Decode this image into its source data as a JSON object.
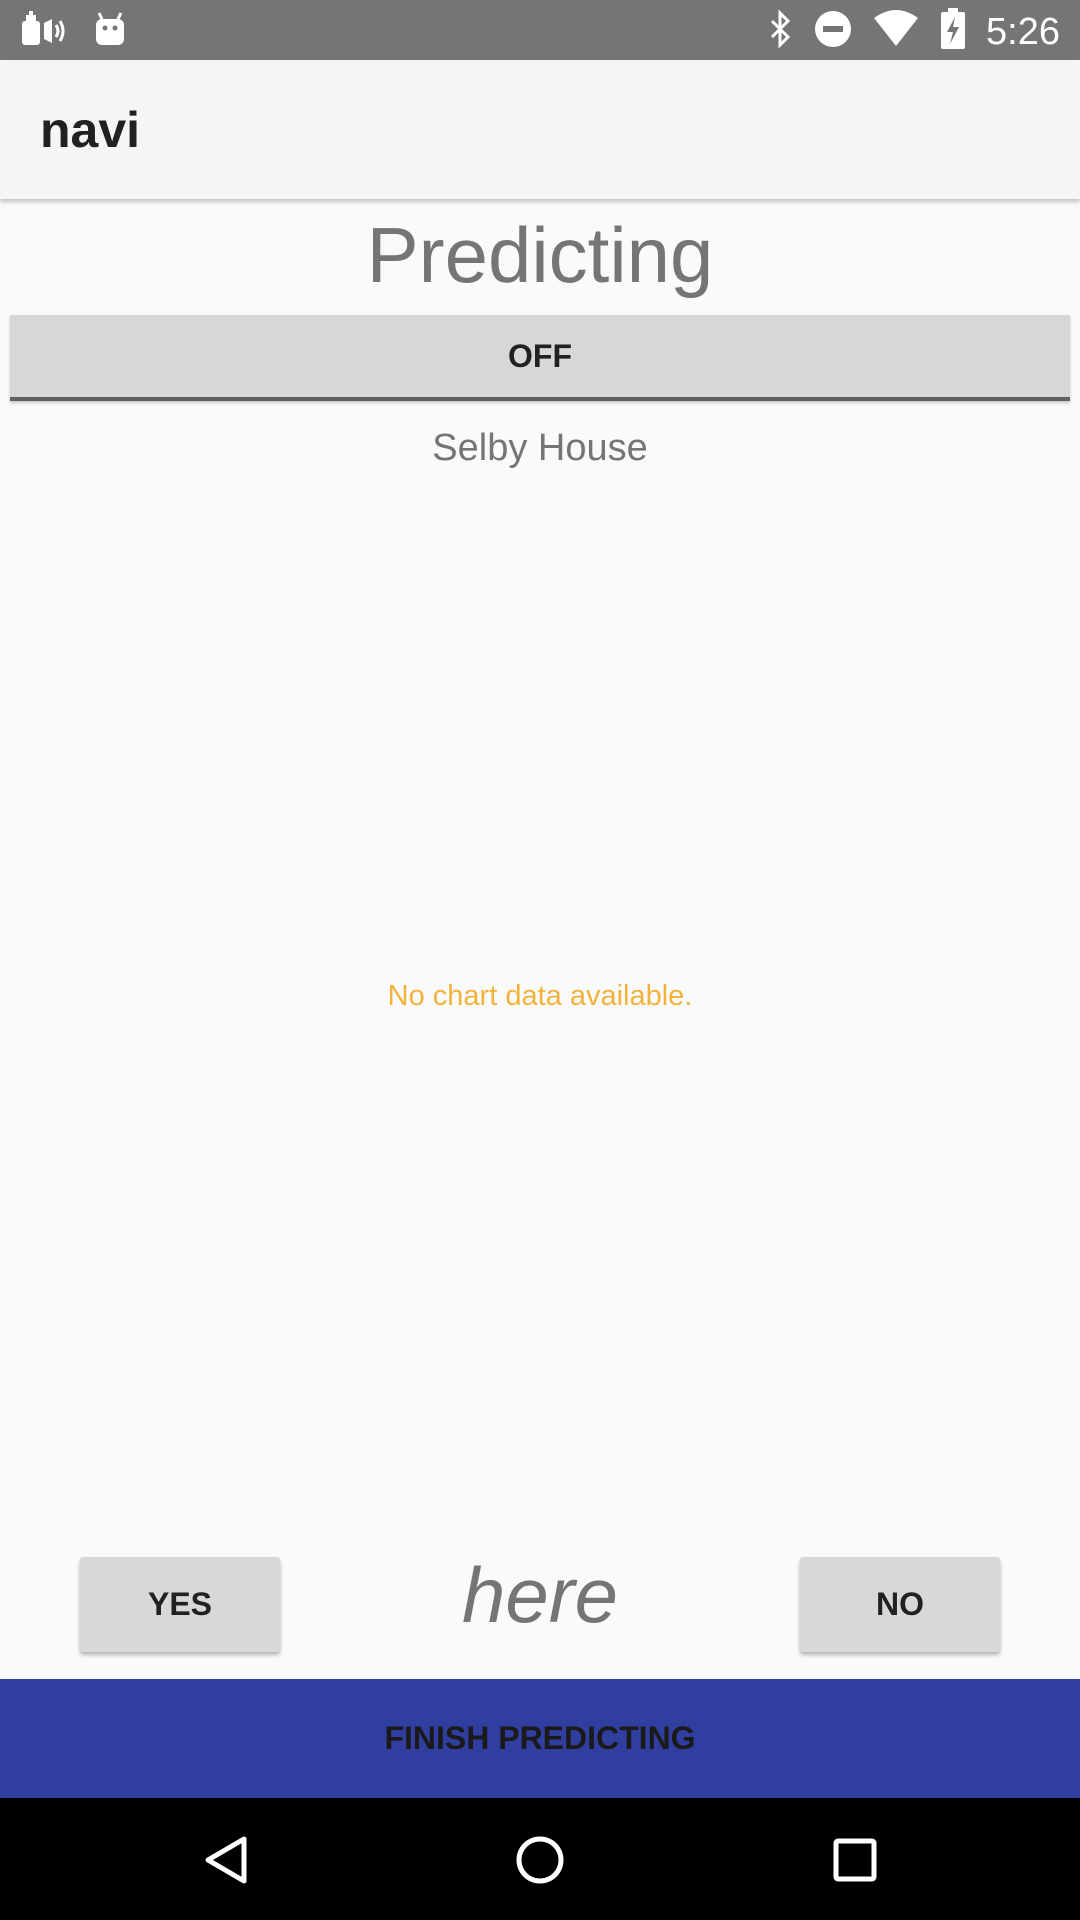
{
  "status_bar": {
    "time": "5:26",
    "left_icons": [
      "notification-speaker-icon",
      "android-icon"
    ],
    "right_icons": [
      "bluetooth-icon",
      "do-not-disturb-icon",
      "wifi-icon",
      "battery-charging-icon"
    ]
  },
  "app_bar": {
    "title": "navi"
  },
  "main": {
    "heading": "Predicting",
    "toggle_label": "OFF",
    "location": "Selby House",
    "empty_chart_message": "No chart data available.",
    "yes_label": "YES",
    "no_label": "NO",
    "center_text": "here",
    "finish_label": "FINISH PREDICTING"
  },
  "nav_bar": {
    "buttons": [
      "back-icon",
      "home-icon",
      "recents-icon"
    ]
  },
  "colors": {
    "status_bar": "#757575",
    "app_bar": "#f5f5f5",
    "background": "#fafafa",
    "button": "#d8d8d8",
    "accent": "#303f9f",
    "empty_chart_text": "#f1b33b",
    "nav_bar": "#000000"
  }
}
